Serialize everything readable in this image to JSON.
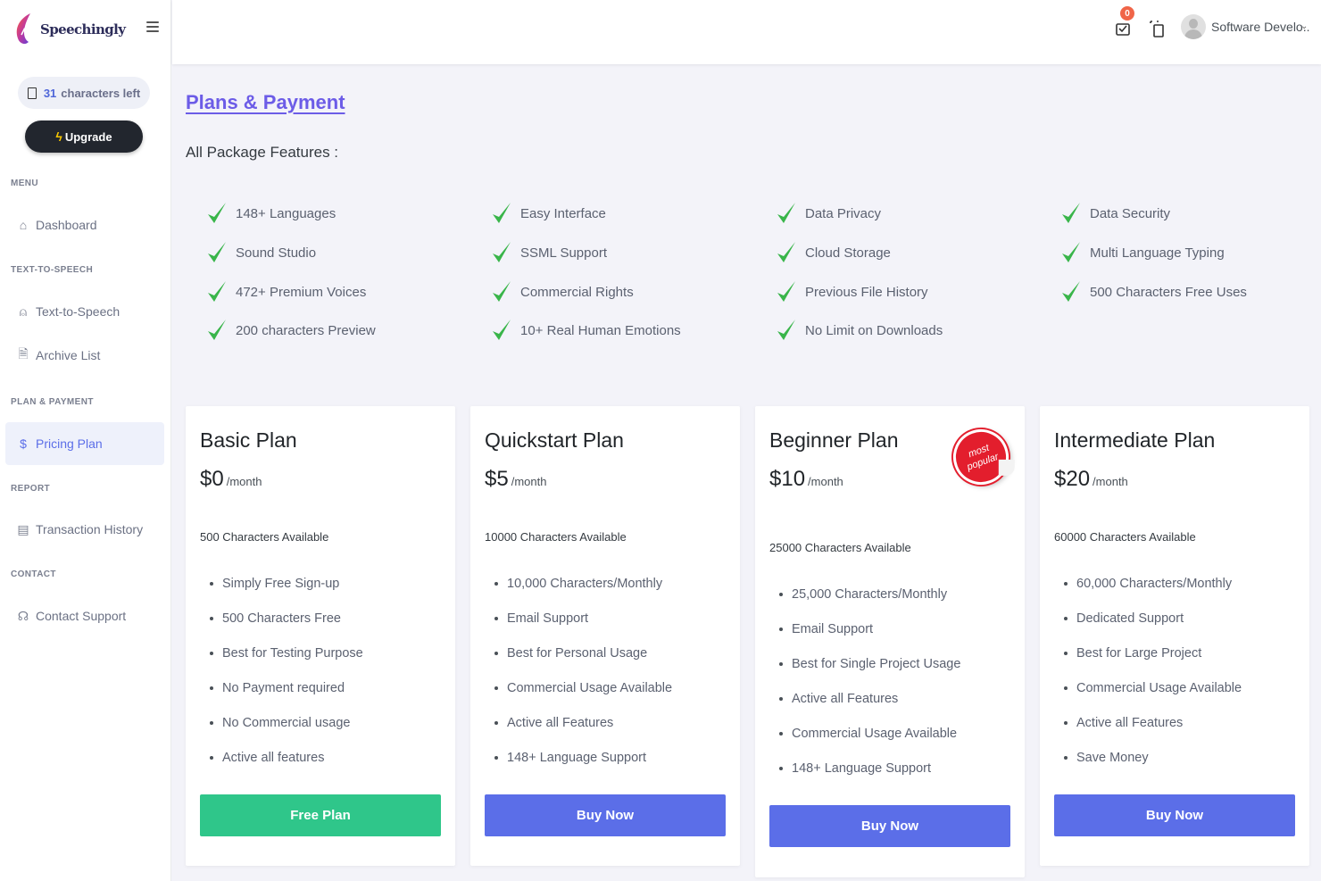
{
  "brand": {
    "name": "Speechingly"
  },
  "sidebar": {
    "chars_left_count": "31",
    "chars_left_label": "characters left",
    "upgrade_label": "Upgrade",
    "sections": {
      "menu": "MENU",
      "tts": "TEXT-TO-SPEECH",
      "plan": "PLAN & PAYMENT",
      "report": "REPORT",
      "contact": "CONTACT"
    },
    "items": {
      "dashboard": "Dashboard",
      "tts": "Text-to-Speech",
      "archive": "Archive List",
      "pricing": "Pricing Plan",
      "transactions": "Transaction History",
      "support": "Contact Support"
    }
  },
  "header": {
    "notification_count": "0",
    "user_name": "Software Develo..",
    "caret": "⌄"
  },
  "main": {
    "title": "Plans & Payment",
    "features_title": "All Package Features :",
    "features": [
      [
        "148+ Languages",
        "Sound Studio",
        "472+ Premium Voices",
        "200 characters Preview"
      ],
      [
        "Easy Interface",
        "SSML Support",
        "Commercial Rights",
        "10+ Real Human Emotions"
      ],
      [
        "Data Privacy",
        "Cloud Storage",
        "Previous File History",
        "No Limit on Downloads"
      ],
      [
        "Data Security",
        "Multi Language Typing",
        "500 Characters Free Uses"
      ]
    ]
  },
  "plans": [
    {
      "name": "Basic Plan",
      "price": "$0",
      "per": "/month",
      "chars": "500 Characters Available",
      "items": [
        "Simply Free Sign-up",
        "500 Characters Free",
        "Best for Testing Purpose",
        "No Payment required",
        "No Commercial usage",
        "Active all features"
      ],
      "button": "Free Plan"
    },
    {
      "name": "Quickstart Plan",
      "price": "$5",
      "per": "/month",
      "chars": "10000 Characters Available",
      "items": [
        "10,000 Characters/Monthly",
        "Email Support",
        "Best for Personal Usage",
        "Commercial Usage Available",
        "Active all Features",
        "148+ Language Support"
      ],
      "button": "Buy Now"
    },
    {
      "name": "Beginner Plan",
      "price": "$10",
      "per": "/month",
      "chars": "25000 Characters Available",
      "badge_line1": "most",
      "badge_line2": "popular",
      "items": [
        "25,000 Characters/Monthly",
        "Email Support",
        "Best for Single Project Usage",
        "Active all Features",
        "Commercial Usage Available",
        "148+ Language Support"
      ],
      "button": "Buy Now"
    },
    {
      "name": "Intermediate Plan",
      "price": "$20",
      "per": "/month",
      "chars": "60000 Characters Available",
      "items": [
        "60,000 Characters/Monthly",
        "Dedicated Support",
        "Best for Large Project",
        "Commercial Usage Available",
        "Active all Features",
        "Save Money"
      ],
      "button": "Buy Now"
    }
  ],
  "colors": {
    "accent": "#5b6ee8",
    "title": "#6c5ce7",
    "free_button": "#2fc68a",
    "badge": "#e31e2d",
    "check": "#39b54a"
  }
}
